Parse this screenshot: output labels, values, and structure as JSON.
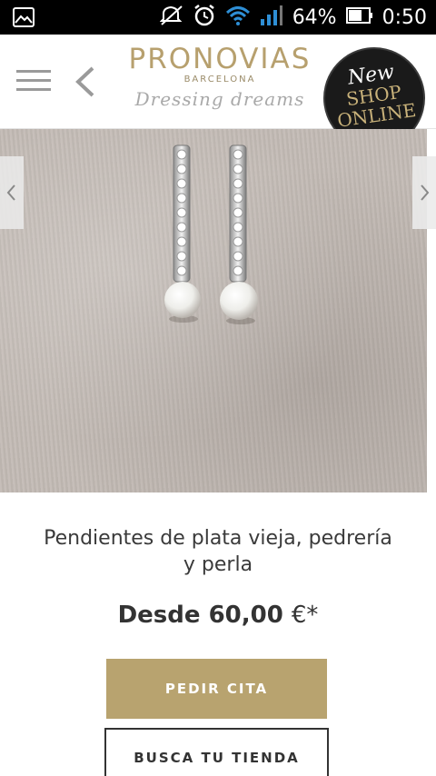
{
  "status_bar": {
    "icons": [
      "gallery-icon",
      "mute-icon",
      "alarm-icon",
      "wifi-icon",
      "signal-icon",
      "battery-icon"
    ],
    "battery": "64%",
    "time": "0:50"
  },
  "header": {
    "menu_icon": "hamburger-menu-icon",
    "back_icon": "chevron-left-icon",
    "brand_name": "PRONOVIAS",
    "brand_city": "BARCELONA",
    "brand_tagline": "Dressing dreams",
    "badge": {
      "line1": "New",
      "line2": "SHOP",
      "line3": "ONLINE"
    }
  },
  "gallery": {
    "prev_icon": "chevron-left-icon",
    "next_icon": "chevron-right-icon"
  },
  "product": {
    "title": "Pendientes de plata vieja, pedrería y perla",
    "price_label": "Desde 60,00",
    "price_suffix": "€*"
  },
  "buttons": {
    "appointment": "PEDIR CITA",
    "store": "BUSCA TU TIENDA"
  },
  "colors": {
    "gold": "#b8a36f",
    "dark": "#333333"
  }
}
